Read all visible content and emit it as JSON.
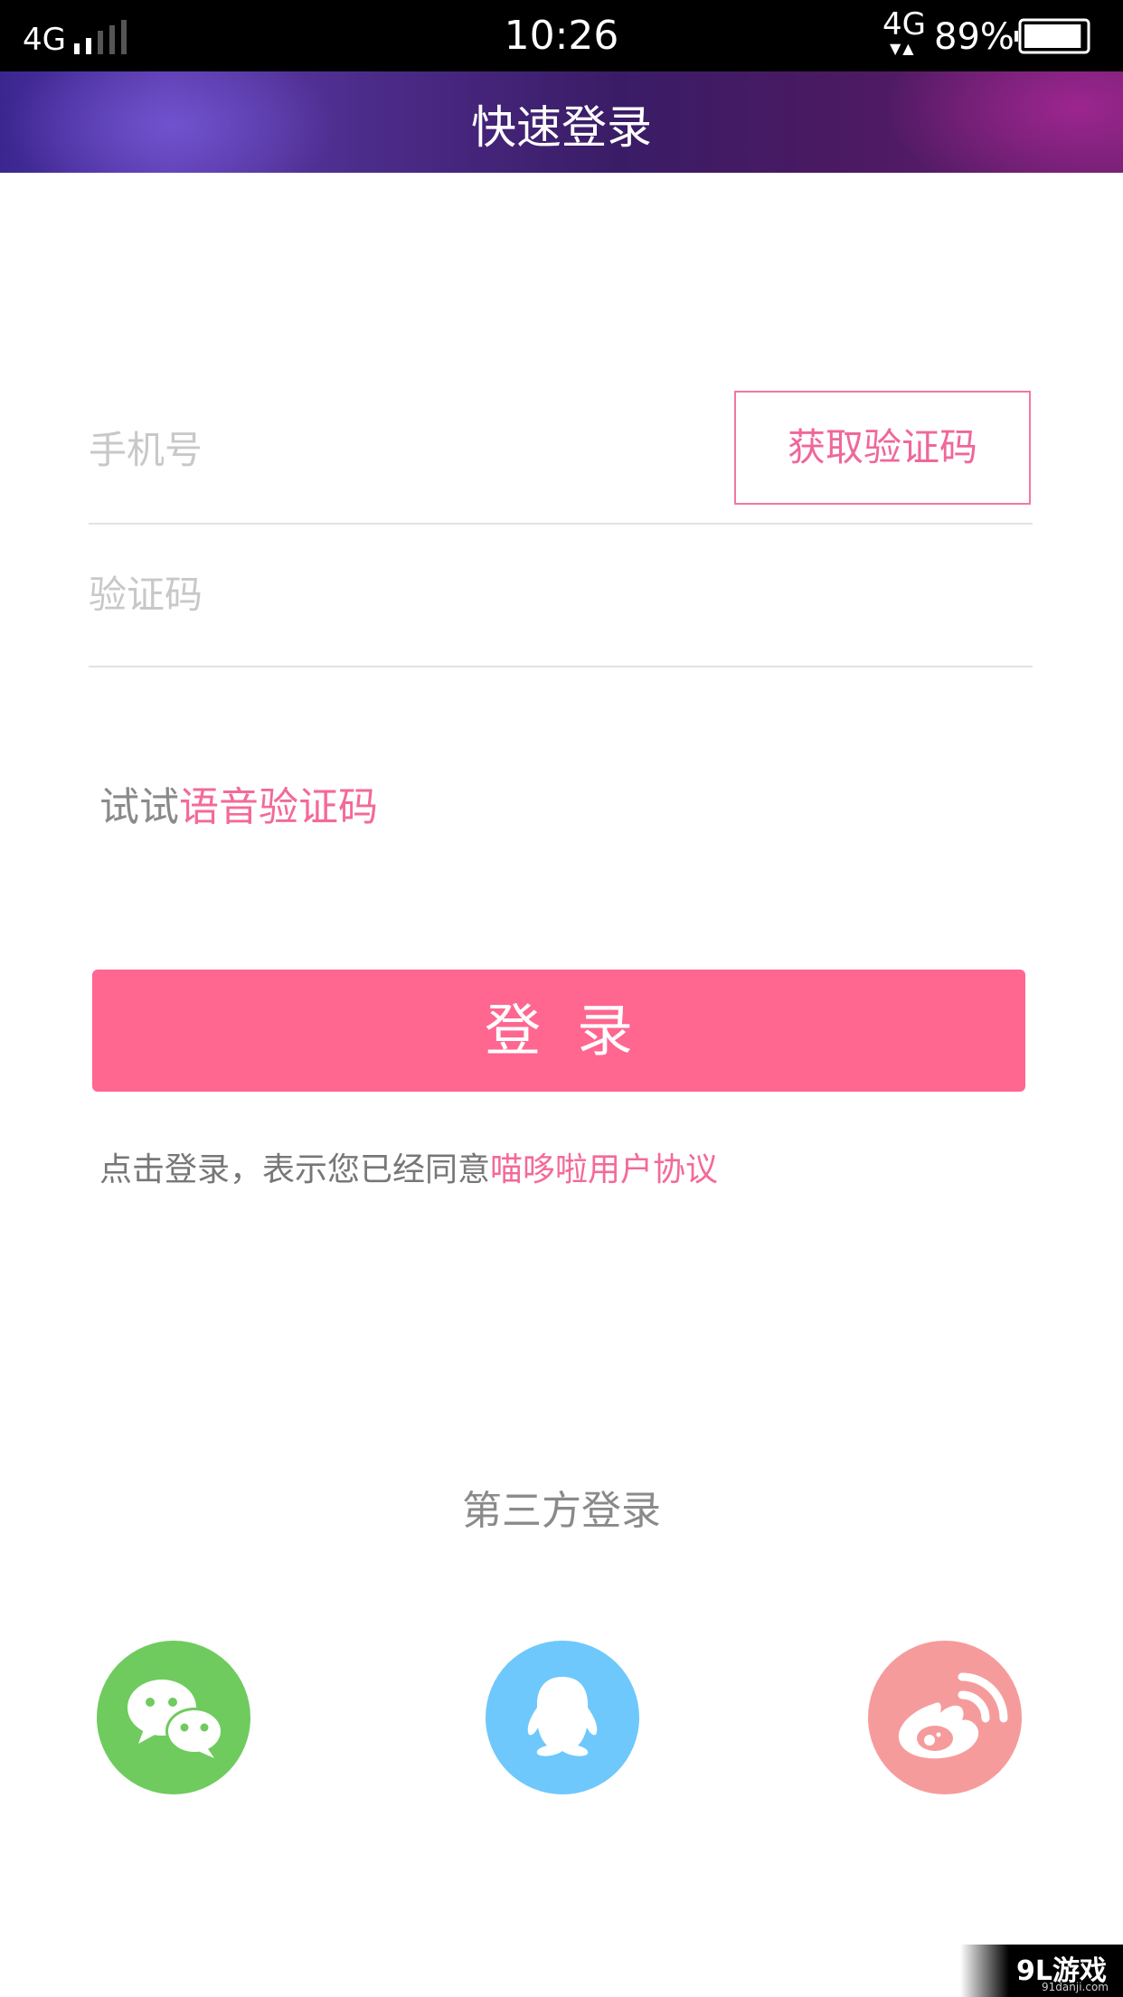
{
  "status_bar": {
    "network": "4G",
    "time": "10:26",
    "network_right": "4G",
    "battery_percent": "89%",
    "battery_level": 0.89
  },
  "header": {
    "title": "快速登录"
  },
  "form": {
    "phone_placeholder": "手机号",
    "get_code_label": "获取验证码",
    "code_placeholder": "验证码",
    "voice_prefix": "试试",
    "voice_link": "语音验证码",
    "login_label": "登录",
    "agreement_prefix": "点击登录，表示您已经同意",
    "agreement_link": "喵哆啦用户协议"
  },
  "third_party": {
    "title": "第三方登录",
    "providers": [
      {
        "icon": "wechat-icon",
        "color": "#6fcb5e"
      },
      {
        "icon": "qq-icon",
        "color": "#6ec8fb"
      },
      {
        "icon": "weibo-icon",
        "color": "#f69b9b"
      }
    ]
  },
  "watermark": {
    "logo": "9L游戏",
    "url": "91danji.com"
  },
  "colors": {
    "accent": "#ff6690",
    "link": "#f36a97"
  }
}
